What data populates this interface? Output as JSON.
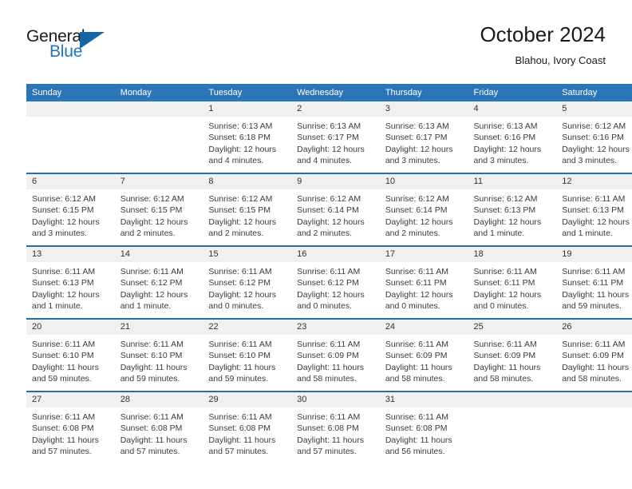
{
  "brand": {
    "name_part1": "General",
    "name_part2": "Blue",
    "triangle_color": "#1565a8",
    "blue_color": "#1e76bd"
  },
  "header": {
    "title": "October 2024",
    "subtitle": "Blahou, Ivory Coast"
  },
  "theme": {
    "header_bg": "#2b76b9",
    "row_rule": "#2b6ca3",
    "daynum_bg": "#f0f0f0",
    "text": "#3a3a3a"
  },
  "columns": [
    "Sunday",
    "Monday",
    "Tuesday",
    "Wednesday",
    "Thursday",
    "Friday",
    "Saturday"
  ],
  "weeks": [
    [
      {
        "day": "",
        "lines": []
      },
      {
        "day": "",
        "lines": []
      },
      {
        "day": "1",
        "lines": [
          "Sunrise: 6:13 AM",
          "Sunset: 6:18 PM",
          "Daylight: 12 hours",
          "and 4 minutes."
        ]
      },
      {
        "day": "2",
        "lines": [
          "Sunrise: 6:13 AM",
          "Sunset: 6:17 PM",
          "Daylight: 12 hours",
          "and 4 minutes."
        ]
      },
      {
        "day": "3",
        "lines": [
          "Sunrise: 6:13 AM",
          "Sunset: 6:17 PM",
          "Daylight: 12 hours",
          "and 3 minutes."
        ]
      },
      {
        "day": "4",
        "lines": [
          "Sunrise: 6:13 AM",
          "Sunset: 6:16 PM",
          "Daylight: 12 hours",
          "and 3 minutes."
        ]
      },
      {
        "day": "5",
        "lines": [
          "Sunrise: 6:12 AM",
          "Sunset: 6:16 PM",
          "Daylight: 12 hours",
          "and 3 minutes."
        ]
      }
    ],
    [
      {
        "day": "6",
        "lines": [
          "Sunrise: 6:12 AM",
          "Sunset: 6:15 PM",
          "Daylight: 12 hours",
          "and 3 minutes."
        ]
      },
      {
        "day": "7",
        "lines": [
          "Sunrise: 6:12 AM",
          "Sunset: 6:15 PM",
          "Daylight: 12 hours",
          "and 2 minutes."
        ]
      },
      {
        "day": "8",
        "lines": [
          "Sunrise: 6:12 AM",
          "Sunset: 6:15 PM",
          "Daylight: 12 hours",
          "and 2 minutes."
        ]
      },
      {
        "day": "9",
        "lines": [
          "Sunrise: 6:12 AM",
          "Sunset: 6:14 PM",
          "Daylight: 12 hours",
          "and 2 minutes."
        ]
      },
      {
        "day": "10",
        "lines": [
          "Sunrise: 6:12 AM",
          "Sunset: 6:14 PM",
          "Daylight: 12 hours",
          "and 2 minutes."
        ]
      },
      {
        "day": "11",
        "lines": [
          "Sunrise: 6:12 AM",
          "Sunset: 6:13 PM",
          "Daylight: 12 hours",
          "and 1 minute."
        ]
      },
      {
        "day": "12",
        "lines": [
          "Sunrise: 6:11 AM",
          "Sunset: 6:13 PM",
          "Daylight: 12 hours",
          "and 1 minute."
        ]
      }
    ],
    [
      {
        "day": "13",
        "lines": [
          "Sunrise: 6:11 AM",
          "Sunset: 6:13 PM",
          "Daylight: 12 hours",
          "and 1 minute."
        ]
      },
      {
        "day": "14",
        "lines": [
          "Sunrise: 6:11 AM",
          "Sunset: 6:12 PM",
          "Daylight: 12 hours",
          "and 1 minute."
        ]
      },
      {
        "day": "15",
        "lines": [
          "Sunrise: 6:11 AM",
          "Sunset: 6:12 PM",
          "Daylight: 12 hours",
          "and 0 minutes."
        ]
      },
      {
        "day": "16",
        "lines": [
          "Sunrise: 6:11 AM",
          "Sunset: 6:12 PM",
          "Daylight: 12 hours",
          "and 0 minutes."
        ]
      },
      {
        "day": "17",
        "lines": [
          "Sunrise: 6:11 AM",
          "Sunset: 6:11 PM",
          "Daylight: 12 hours",
          "and 0 minutes."
        ]
      },
      {
        "day": "18",
        "lines": [
          "Sunrise: 6:11 AM",
          "Sunset: 6:11 PM",
          "Daylight: 12 hours",
          "and 0 minutes."
        ]
      },
      {
        "day": "19",
        "lines": [
          "Sunrise: 6:11 AM",
          "Sunset: 6:11 PM",
          "Daylight: 11 hours",
          "and 59 minutes."
        ]
      }
    ],
    [
      {
        "day": "20",
        "lines": [
          "Sunrise: 6:11 AM",
          "Sunset: 6:10 PM",
          "Daylight: 11 hours",
          "and 59 minutes."
        ]
      },
      {
        "day": "21",
        "lines": [
          "Sunrise: 6:11 AM",
          "Sunset: 6:10 PM",
          "Daylight: 11 hours",
          "and 59 minutes."
        ]
      },
      {
        "day": "22",
        "lines": [
          "Sunrise: 6:11 AM",
          "Sunset: 6:10 PM",
          "Daylight: 11 hours",
          "and 59 minutes."
        ]
      },
      {
        "day": "23",
        "lines": [
          "Sunrise: 6:11 AM",
          "Sunset: 6:09 PM",
          "Daylight: 11 hours",
          "and 58 minutes."
        ]
      },
      {
        "day": "24",
        "lines": [
          "Sunrise: 6:11 AM",
          "Sunset: 6:09 PM",
          "Daylight: 11 hours",
          "and 58 minutes."
        ]
      },
      {
        "day": "25",
        "lines": [
          "Sunrise: 6:11 AM",
          "Sunset: 6:09 PM",
          "Daylight: 11 hours",
          "and 58 minutes."
        ]
      },
      {
        "day": "26",
        "lines": [
          "Sunrise: 6:11 AM",
          "Sunset: 6:09 PM",
          "Daylight: 11 hours",
          "and 58 minutes."
        ]
      }
    ],
    [
      {
        "day": "27",
        "lines": [
          "Sunrise: 6:11 AM",
          "Sunset: 6:08 PM",
          "Daylight: 11 hours",
          "and 57 minutes."
        ]
      },
      {
        "day": "28",
        "lines": [
          "Sunrise: 6:11 AM",
          "Sunset: 6:08 PM",
          "Daylight: 11 hours",
          "and 57 minutes."
        ]
      },
      {
        "day": "29",
        "lines": [
          "Sunrise: 6:11 AM",
          "Sunset: 6:08 PM",
          "Daylight: 11 hours",
          "and 57 minutes."
        ]
      },
      {
        "day": "30",
        "lines": [
          "Sunrise: 6:11 AM",
          "Sunset: 6:08 PM",
          "Daylight: 11 hours",
          "and 57 minutes."
        ]
      },
      {
        "day": "31",
        "lines": [
          "Sunrise: 6:11 AM",
          "Sunset: 6:08 PM",
          "Daylight: 11 hours",
          "and 56 minutes."
        ]
      },
      {
        "day": "",
        "lines": []
      },
      {
        "day": "",
        "lines": []
      }
    ]
  ]
}
